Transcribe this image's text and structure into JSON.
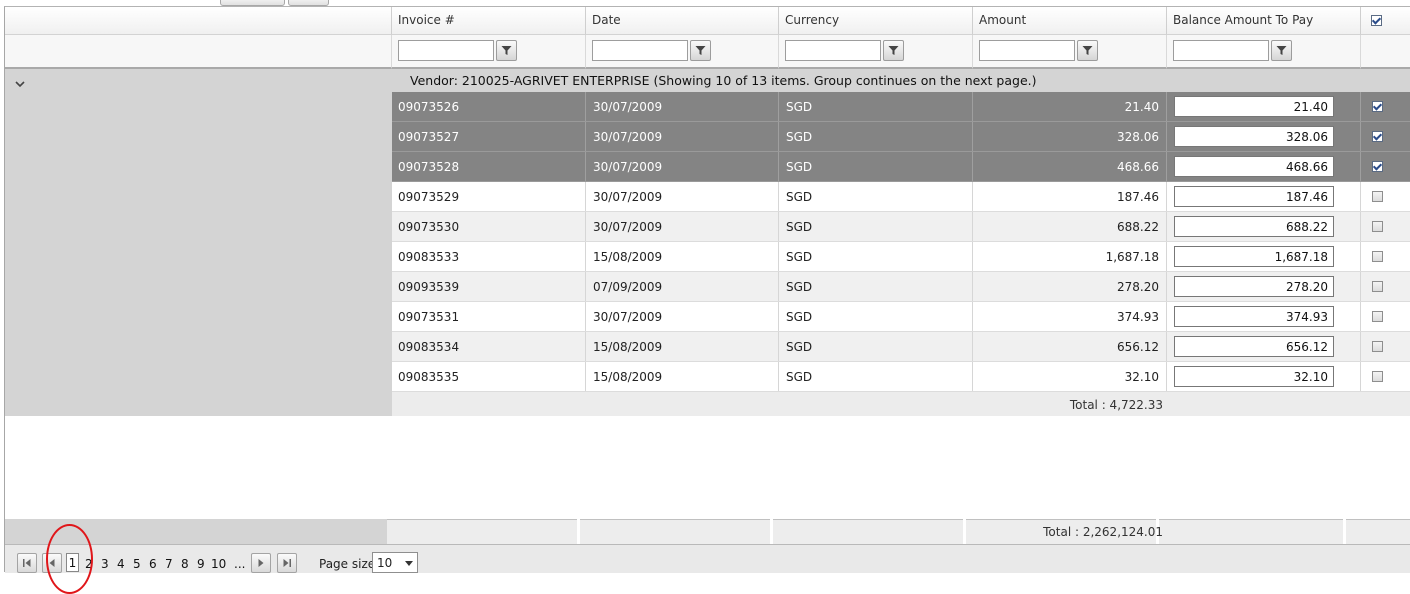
{
  "columns": {
    "invoice": "Invoice #",
    "date": "Date",
    "currency": "Currency",
    "amount": "Amount",
    "balance": "Balance Amount To Pay"
  },
  "select_all_checked": true,
  "group": {
    "label": "Vendor: 210025-AGRIVET ENTERPRISE (Showing 10 of 13 items. Group continues on the next page.)",
    "total": "Total : 4,722.33"
  },
  "rows": [
    {
      "invoice": "09073526",
      "date": "30/07/2009",
      "currency": "SGD",
      "amount": "21.40",
      "balance": "21.40",
      "checked": true
    },
    {
      "invoice": "09073527",
      "date": "30/07/2009",
      "currency": "SGD",
      "amount": "328.06",
      "balance": "328.06",
      "checked": true
    },
    {
      "invoice": "09073528",
      "date": "30/07/2009",
      "currency": "SGD",
      "amount": "468.66",
      "balance": "468.66",
      "checked": true
    },
    {
      "invoice": "09073529",
      "date": "30/07/2009",
      "currency": "SGD",
      "amount": "187.46",
      "balance": "187.46",
      "checked": false
    },
    {
      "invoice": "09073530",
      "date": "30/07/2009",
      "currency": "SGD",
      "amount": "688.22",
      "balance": "688.22",
      "checked": false
    },
    {
      "invoice": "09083533",
      "date": "15/08/2009",
      "currency": "SGD",
      "amount": "1,687.18",
      "balance": "1,687.18",
      "checked": false
    },
    {
      "invoice": "09093539",
      "date": "07/09/2009",
      "currency": "SGD",
      "amount": "278.20",
      "balance": "278.20",
      "checked": false
    },
    {
      "invoice": "09073531",
      "date": "30/07/2009",
      "currency": "SGD",
      "amount": "374.93",
      "balance": "374.93",
      "checked": false
    },
    {
      "invoice": "09083534",
      "date": "15/08/2009",
      "currency": "SGD",
      "amount": "656.12",
      "balance": "656.12",
      "checked": false
    },
    {
      "invoice": "09083535",
      "date": "15/08/2009",
      "currency": "SGD",
      "amount": "32.10",
      "balance": "32.10",
      "checked": false
    }
  ],
  "grand_total": "Total : 2,262,124.01",
  "pager": {
    "pages": [
      "1",
      "2",
      "3",
      "4",
      "5",
      "6",
      "7",
      "8",
      "9",
      "10",
      "..."
    ],
    "current": "1",
    "page_size_label": "Page size:",
    "page_size": "10"
  },
  "icons": {
    "filter": "filter-funnel-icon",
    "expand": "chevron-down-icon",
    "first": "first-page-icon",
    "prev": "prev-page-icon",
    "next": "next-page-icon",
    "last": "last-page-icon",
    "dropdown": "dropdown-arrow-icon"
  },
  "colors": {
    "selected_row": "#848484",
    "group_bg": "#d4d4d4",
    "annotation": "#e0161a"
  }
}
